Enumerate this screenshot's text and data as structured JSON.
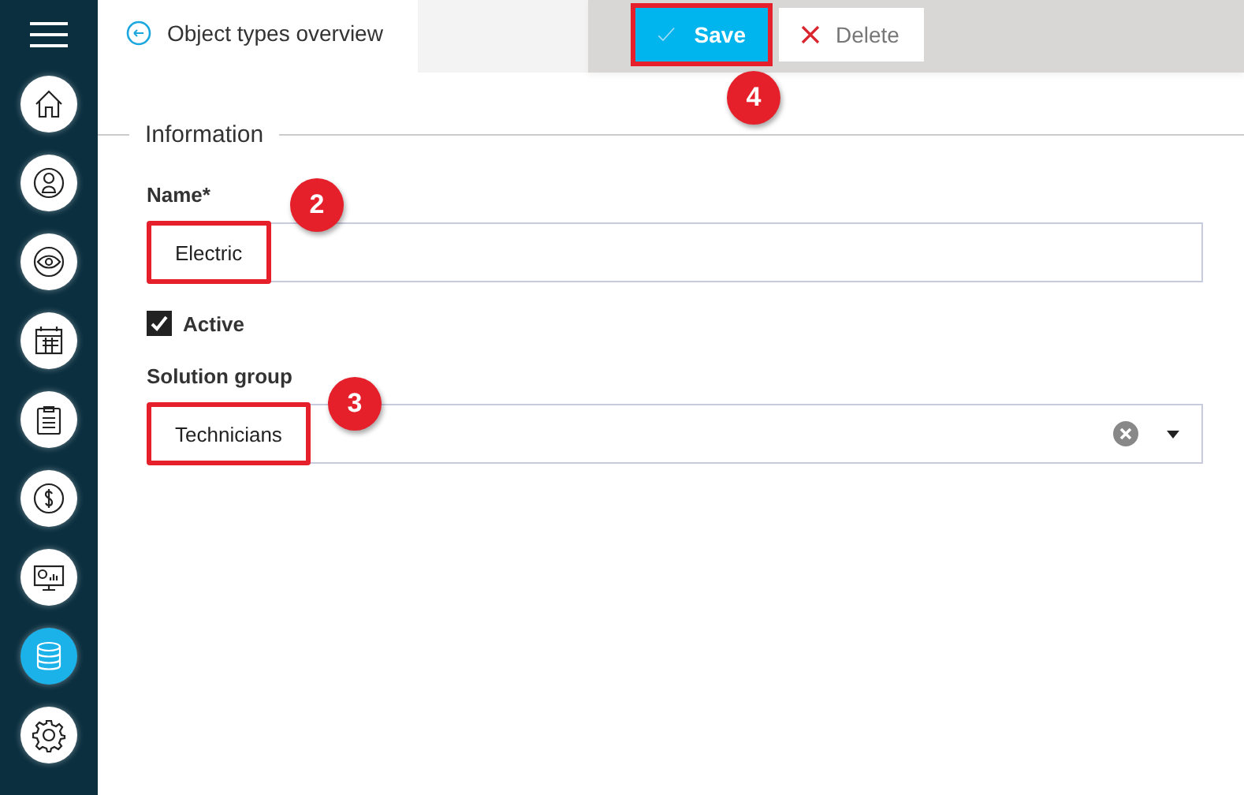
{
  "sidebar": {
    "items": [
      {
        "selected": false
      },
      {
        "selected": false
      },
      {
        "selected": false
      },
      {
        "selected": false
      },
      {
        "selected": false
      },
      {
        "selected": false
      },
      {
        "selected": false
      },
      {
        "selected": true
      },
      {
        "selected": false
      }
    ]
  },
  "breadcrumb": {
    "label": "Object types overview"
  },
  "toolbar": {
    "buttons": [
      {
        "kind": "save",
        "label": "Save",
        "highlighted": true,
        "callout": "4"
      },
      {
        "kind": "delete",
        "label": "Delete",
        "highlighted": false
      }
    ]
  },
  "section": {
    "title": "Information"
  },
  "form": {
    "name": {
      "label": "Name*",
      "value": "Electric",
      "highlighted": true,
      "callout": "2"
    },
    "active": {
      "label": "Active",
      "checked": true
    },
    "solution_group": {
      "label": "Solution group",
      "value": "Technicians",
      "highlighted": true,
      "callout": "3"
    }
  }
}
